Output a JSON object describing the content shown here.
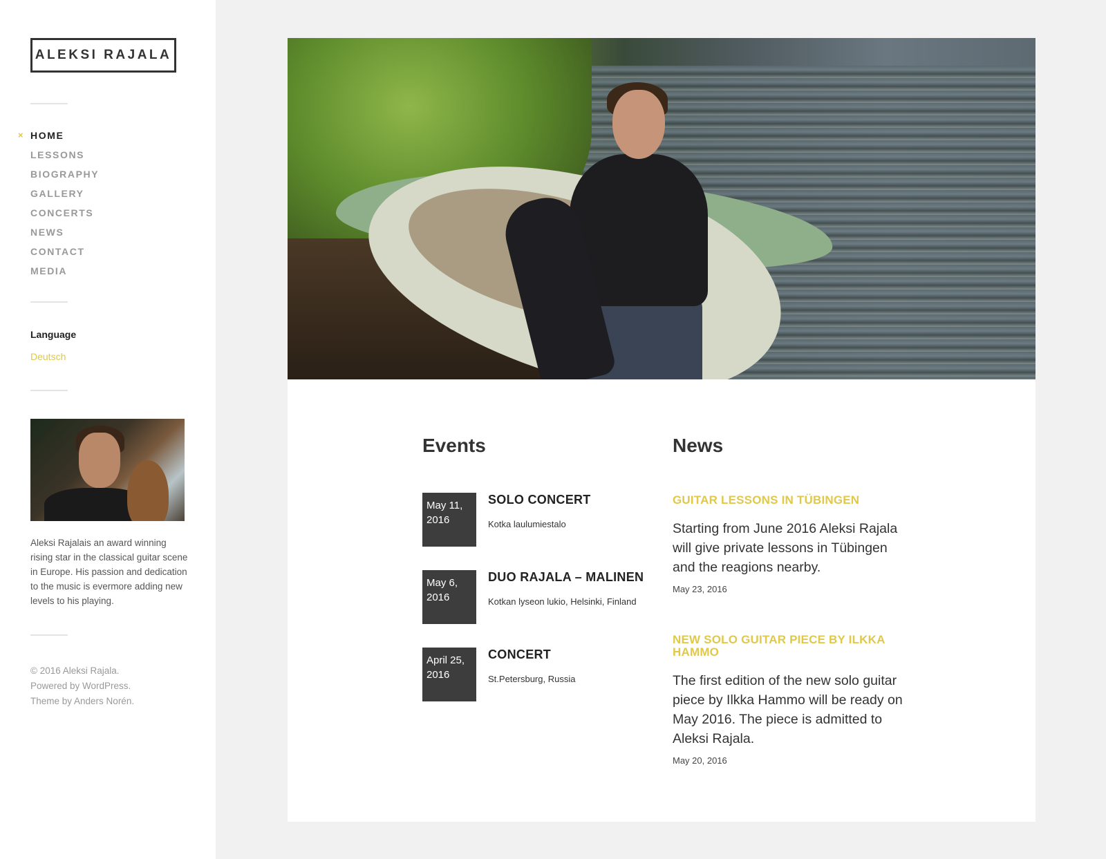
{
  "site": {
    "title": "ALEKSI RAJALA"
  },
  "nav": {
    "active_marker": "×",
    "items": [
      "HOME",
      "LESSONS",
      "BIOGRAPHY",
      "GALLERY",
      "CONCERTS",
      "NEWS",
      "CONTACT",
      "MEDIA"
    ]
  },
  "language_widget": {
    "title": "Language",
    "link": "Deutsch"
  },
  "bio": "Aleksi Rajalais an award winning rising star in the classical guitar scene in Europe. His passion and dedication to the music is evermore adding new levels to his playing.",
  "footer": {
    "copyright": "© 2016 Aleksi Rajala.",
    "powered": "Powered by WordPress.",
    "theme": "Theme by Anders Norén."
  },
  "events": {
    "title": "Events",
    "items": [
      {
        "date": "May 11, 2016",
        "title": "SOLO CONCERT",
        "place": "Kotka laulumiestalo"
      },
      {
        "date": "May 6, 2016",
        "title": "DUO RAJALA – MALINEN",
        "place": "Kotkan lyseon lukio, Helsinki, Finland"
      },
      {
        "date": "April 25, 2016",
        "title": "CONCERT",
        "place": "St.Petersburg, Russia"
      }
    ]
  },
  "news": {
    "title": "News",
    "items": [
      {
        "title": "GUITAR LESSONS IN TÜBINGEN",
        "excerpt": "Starting from June 2016 Aleksi Rajala will give private lessons in Tübingen and the reagions nearby.",
        "date": "May 23, 2016"
      },
      {
        "title": "NEW SOLO GUITAR PIECE BY ILKKA HAMMO",
        "excerpt": "The first edition of the new solo guitar piece by Ilkka Hammo will be ready on May 2016. The piece is admitted to Aleksi Rajala.",
        "date": "May 20, 2016"
      }
    ]
  },
  "colors": {
    "accent": "#e0c84a",
    "dark": "#333333",
    "background": "#f1f1f1"
  }
}
